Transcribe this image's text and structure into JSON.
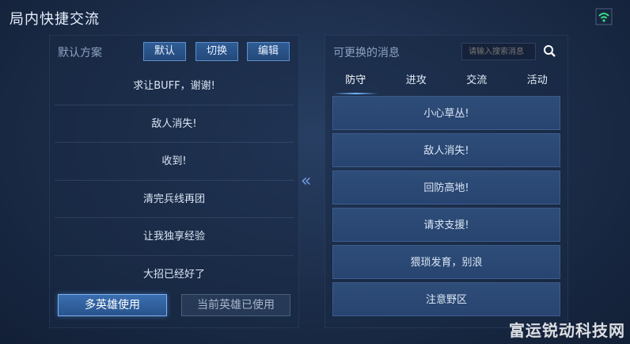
{
  "title": "局内快捷交流",
  "left_panel": {
    "title": "默认方案",
    "header_buttons": [
      "默认",
      "切换",
      "编辑"
    ],
    "messages": [
      "求让BUFF，谢谢!",
      "敌人消失!",
      "收到!",
      "清完兵线再团",
      "让我独享经验",
      "大招已经好了"
    ],
    "primary_button": "多英雄使用",
    "secondary_button": "当前英雄已使用"
  },
  "arrow": "«",
  "right_panel": {
    "title": "可更换的消息",
    "search_placeholder": "请输入搜索消息",
    "tabs": [
      "防守",
      "进攻",
      "交流",
      "活动"
    ],
    "active_tab": "防守",
    "options": [
      "小心草丛!",
      "敌人消失!",
      "回防高地!",
      "请求支援!",
      "猥琐发育，别浪",
      "注意野区"
    ]
  },
  "watermark": "富运锐动科技网",
  "colors": {
    "accent": "#5c8fd0",
    "signal": "#3ddc84"
  }
}
